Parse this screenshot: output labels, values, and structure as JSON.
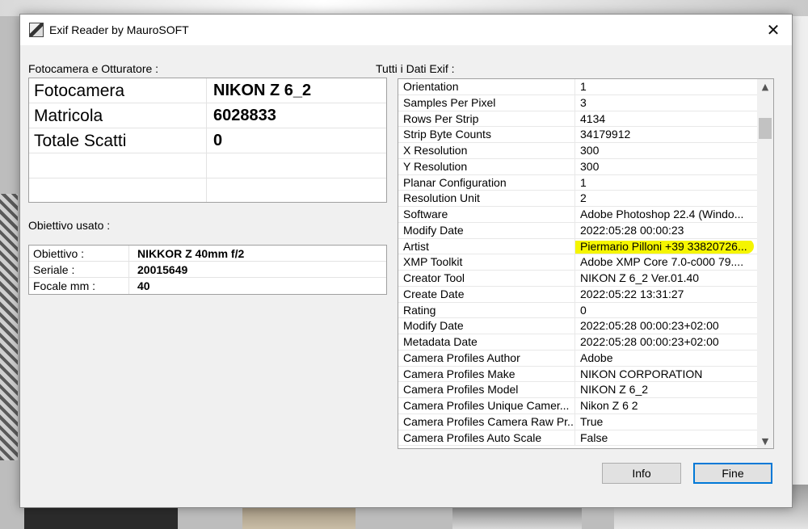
{
  "window": {
    "title": "Exif Reader by MauroSOFT",
    "close_glyph": "✕"
  },
  "camera_section": {
    "label": "Fotocamera e Otturatore :",
    "rows": [
      {
        "key": "Fotocamera",
        "value": "NIKON Z 6_2"
      },
      {
        "key": "Matricola",
        "value": "6028833"
      },
      {
        "key": "Totale Scatti",
        "value": "0"
      },
      {
        "key": "",
        "value": ""
      },
      {
        "key": "",
        "value": ""
      }
    ]
  },
  "lens_section": {
    "label": "Obiettivo usato :",
    "rows": [
      {
        "key": "Obiettivo :",
        "value": "NIKKOR Z 40mm f/2"
      },
      {
        "key": "Seriale :",
        "value": "20015649"
      },
      {
        "key": "Focale mm :",
        "value": "40"
      }
    ]
  },
  "exif_section": {
    "label": "Tutti i Dati Exif :",
    "rows": [
      {
        "key": "Orientation",
        "value": "1"
      },
      {
        "key": "Samples Per Pixel",
        "value": "3"
      },
      {
        "key": "Rows Per Strip",
        "value": "4134"
      },
      {
        "key": "Strip Byte Counts",
        "value": "34179912"
      },
      {
        "key": "X Resolution",
        "value": "300"
      },
      {
        "key": "Y Resolution",
        "value": "300"
      },
      {
        "key": "Planar Configuration",
        "value": "1"
      },
      {
        "key": "Resolution Unit",
        "value": "2"
      },
      {
        "key": "Software",
        "value": "Adobe Photoshop 22.4 (Windo..."
      },
      {
        "key": "Modify Date",
        "value": "2022:05:28 00:00:23"
      },
      {
        "key": "Artist",
        "value": "Piermario Pilloni +39 33820726..."
      },
      {
        "key": "XMP Toolkit",
        "value": "Adobe XMP Core 7.0-c000 79...."
      },
      {
        "key": "Creator Tool",
        "value": "NIKON Z 6_2 Ver.01.40"
      },
      {
        "key": "Create Date",
        "value": "2022:05:22 13:31:27"
      },
      {
        "key": "Rating",
        "value": "0"
      },
      {
        "key": "Modify Date",
        "value": "2022:05:28 00:00:23+02:00"
      },
      {
        "key": "Metadata Date",
        "value": "2022:05:28 00:00:23+02:00"
      },
      {
        "key": "Camera Profiles Author",
        "value": "Adobe"
      },
      {
        "key": "Camera Profiles Make",
        "value": "NIKON CORPORATION"
      },
      {
        "key": "Camera Profiles Model",
        "value": "NIKON Z 6_2"
      },
      {
        "key": "Camera Profiles Unique Camer...",
        "value": "Nikon Z 6 2"
      },
      {
        "key": "Camera Profiles Camera Raw Pr...",
        "value": "True"
      },
      {
        "key": "Camera Profiles Auto Scale",
        "value": "False"
      }
    ],
    "highlighted_row_index": 10,
    "highlight_color": "#f5f500"
  },
  "buttons": {
    "info_label": "Info",
    "fine_label": "Fine"
  },
  "scrollbar": {
    "up_glyph": "▲",
    "down_glyph": "▼"
  }
}
